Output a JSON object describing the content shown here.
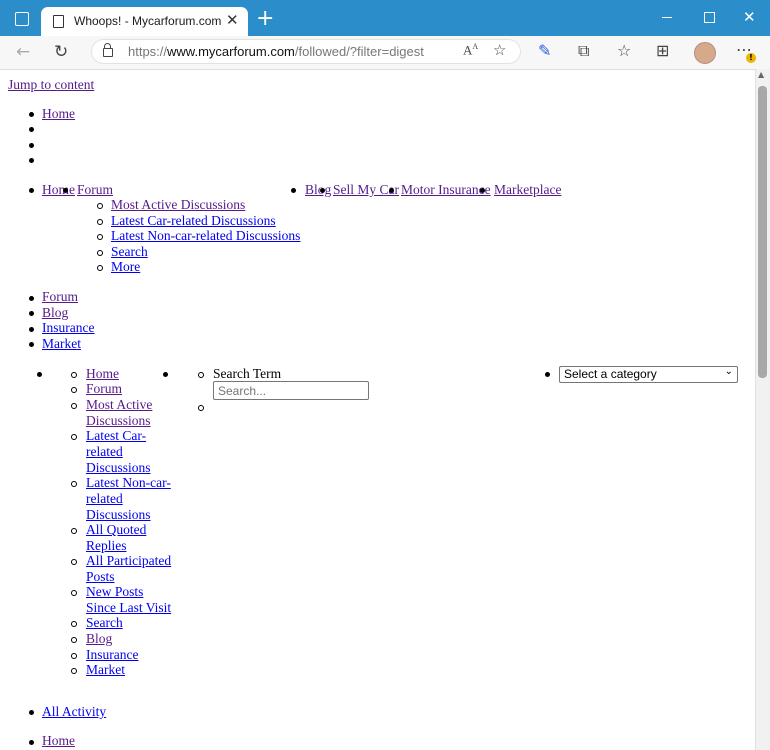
{
  "browser": {
    "tab_title": "Whoops! - Mycarforum.com",
    "new_tab": "+",
    "url_prefix": "https://",
    "url_domain": "www.mycarforum.com",
    "url_path": "/followed/?filter=digest",
    "icons": [
      "tab-actions-icon",
      "close-tab-icon",
      "new-tab-icon",
      "minimize-icon",
      "maximize-icon",
      "close-window-icon",
      "back-icon",
      "refresh-icon",
      "lock-icon",
      "read-aloud-icon",
      "add-favorite-icon",
      "extension-icon",
      "extensions-icon",
      "favorites-icon",
      "collections-icon",
      "profile-avatar",
      "more-icon"
    ]
  },
  "page": {
    "skip_link": "Jump to content",
    "top_list": {
      "home": "Home"
    },
    "primary_nav": {
      "home": "Home",
      "forum": "Forum",
      "blog": "Blog",
      "sell": "Sell My Car",
      "insurance": "Motor Insurance",
      "market": "Marketplace",
      "forum_submenu": [
        "Most Active Discussions",
        "Latest Car-related Discussions",
        "Latest Non-car-related Discussions",
        "Search",
        "More"
      ]
    },
    "mobile_nav": [
      "Forum",
      "Blog",
      "Insurance",
      "Market"
    ],
    "drawer_menu": {
      "home": "Home",
      "forum": "Forum",
      "most_active": [
        "Most Active",
        "Discussions"
      ],
      "latest_car": [
        "Latest Car-",
        "related",
        "Discussions"
      ],
      "latest_noncar": [
        "Latest Non-car-",
        "related",
        "Discussions"
      ],
      "quoted": [
        "All Quoted",
        "Replies"
      ],
      "participated": [
        "All Participated",
        "Posts"
      ],
      "new_posts": [
        "New Posts",
        "Since Last Visit"
      ],
      "search": "Search",
      "blog": "Blog",
      "insurance": "Insurance",
      "market": "Market"
    },
    "search": {
      "label": "Search Term",
      "placeholder": "Search...",
      "category_selected": "Select a category"
    },
    "activity": "All Activity",
    "breadcrumb_home": "Home"
  }
}
